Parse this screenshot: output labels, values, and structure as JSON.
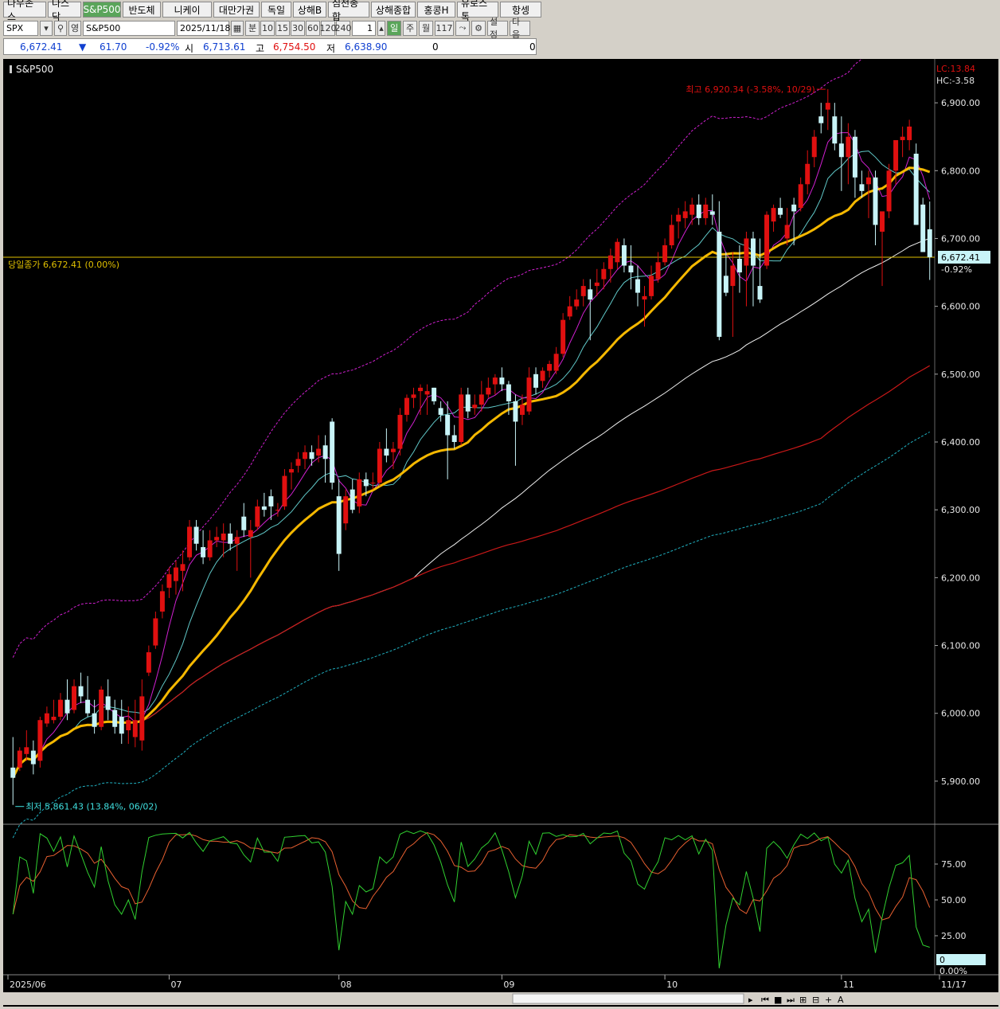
{
  "tabs": [
    "다우존스",
    "나스닥",
    "S&P500",
    "반도체",
    "니케이",
    "대만가권",
    "독일",
    "상해B",
    "심천종합",
    "상해종합",
    "홍콩H",
    "유로스톡",
    "항셍"
  ],
  "active_tab": "S&P500",
  "toolbar": {
    "symbol": "SPX",
    "symbol_name": "S&P500",
    "date": "2025/11/18",
    "period_buttons": [
      "분",
      "10",
      "15",
      "30",
      "60",
      "120",
      "240"
    ],
    "tick_value": "1",
    "day_label": "일",
    "week_label": "주",
    "month_label": "월",
    "count": "117",
    "settings_label": "설정",
    "next_label": "다음",
    "ref_label": "영"
  },
  "quote": {
    "last": "6,672.41",
    "change": "61.70",
    "change_pct": "-0.92%",
    "open_label": "시",
    "open": "6,713.61",
    "high_label": "고",
    "high": "6,754.50",
    "low_label": "저",
    "low": "6,638.90",
    "vol1": "0",
    "vol2": "0"
  },
  "colors": {
    "up": "#e01010",
    "down": "#c8f4f8",
    "ma_yellow": "#f5b800",
    "ma_white": "#f0f0f0",
    "ma_red": "#c81818",
    "ma_cyan": "#20b0c0",
    "ma_magenta": "#d020d0",
    "close_line": "#e0c000"
  },
  "chart_data": {
    "type": "candlestick",
    "title": "S&P500",
    "y_ticks": [
      "6,900.00",
      "6,800.00",
      "6,700.00",
      "6,600.00",
      "6,500.00",
      "6,400.00",
      "6,300.00",
      "6,200.00",
      "6,100.00",
      "6,000.00",
      "5,900.00"
    ],
    "ylim": [
      5840,
      6960
    ],
    "x_labels": [
      "2025/06",
      "07",
      "08",
      "09",
      "10",
      "11",
      "11/17"
    ],
    "lc_label": "LC:13.84",
    "hc_label": "HC:-3.58",
    "close_label": "당일종가 6,672.41 (0.00%)",
    "close_value": 6672.41,
    "last_price_label": "6,672.41",
    "last_change_label": "-0.92%",
    "high_annotation": "최고 6,920.34 (-3.58%, 10/29)",
    "low_annotation": "최저 5,861.43 (13.84%, 06/02)",
    "candles": [
      [
        5920,
        5965,
        5865,
        5905
      ],
      [
        5920,
        5950,
        5915,
        5945
      ],
      [
        5940,
        5975,
        5930,
        5950
      ],
      [
        5945,
        5960,
        5910,
        5925
      ],
      [
        5930,
        5995,
        5920,
        5990
      ],
      [
        5985,
        6010,
        5980,
        6000
      ],
      [
        5990,
        6020,
        5985,
        5995
      ],
      [
        5995,
        6030,
        5990,
        6020
      ],
      [
        6020,
        6050,
        5990,
        6000
      ],
      [
        6005,
        6050,
        6000,
        6040
      ],
      [
        6040,
        6060,
        6015,
        6025
      ],
      [
        6020,
        6055,
        5995,
        6000
      ],
      [
        6000,
        6020,
        5970,
        5980
      ],
      [
        5980,
        6040,
        5975,
        6035
      ],
      [
        6025,
        6050,
        5990,
        6005
      ],
      [
        6005,
        6020,
        5970,
        5980
      ],
      [
        5995,
        6020,
        5955,
        5970
      ],
      [
        5975,
        6010,
        5955,
        5990
      ],
      [
        5965,
        6020,
        5950,
        5990
      ],
      [
        5960,
        6050,
        5945,
        6025
      ],
      [
        6060,
        6100,
        6055,
        6090
      ],
      [
        6100,
        6150,
        6095,
        6140
      ],
      [
        6150,
        6190,
        6140,
        6180
      ],
      [
        6185,
        6215,
        6170,
        6205
      ],
      [
        6195,
        6225,
        6175,
        6215
      ],
      [
        6210,
        6240,
        6180,
        6220
      ],
      [
        6230,
        6285,
        6225,
        6275
      ],
      [
        6275,
        6285,
        6240,
        6250
      ],
      [
        6245,
        6270,
        6220,
        6230
      ],
      [
        6230,
        6270,
        6225,
        6255
      ],
      [
        6255,
        6275,
        6245,
        6260
      ],
      [
        6255,
        6280,
        6230,
        6265
      ],
      [
        6265,
        6280,
        6240,
        6250
      ],
      [
        6250,
        6270,
        6210,
        6260
      ],
      [
        6290,
        6310,
        6260,
        6270
      ],
      [
        6260,
        6285,
        6200,
        6270
      ],
      [
        6275,
        6315,
        6270,
        6305
      ],
      [
        6305,
        6325,
        6290,
        6300
      ],
      [
        6320,
        6330,
        6285,
        6305
      ],
      [
        6300,
        6310,
        6290,
        6300
      ],
      [
        6305,
        6360,
        6300,
        6350
      ],
      [
        6355,
        6370,
        6330,
        6360
      ],
      [
        6365,
        6385,
        6355,
        6375
      ],
      [
        6375,
        6395,
        6360,
        6385
      ],
      [
        6385,
        6395,
        6365,
        6375
      ],
      [
        6380,
        6410,
        6370,
        6390
      ],
      [
        6395,
        6410,
        6340,
        6375
      ],
      [
        6430,
        6435,
        6330,
        6340
      ],
      [
        6320,
        6345,
        6210,
        6235
      ],
      [
        6280,
        6330,
        6270,
        6320
      ],
      [
        6330,
        6345,
        6295,
        6300
      ],
      [
        6305,
        6355,
        6295,
        6345
      ],
      [
        6345,
        6355,
        6320,
        6335
      ],
      [
        6340,
        6355,
        6330,
        6340
      ],
      [
        6340,
        6400,
        6335,
        6390
      ],
      [
        6390,
        6420,
        6370,
        6380
      ],
      [
        6385,
        6400,
        6360,
        6390
      ],
      [
        6390,
        6450,
        6380,
        6440
      ],
      [
        6440,
        6470,
        6430,
        6465
      ],
      [
        6465,
        6480,
        6450,
        6470
      ],
      [
        6475,
        6485,
        6440,
        6480
      ],
      [
        6470,
        6485,
        6440,
        6475
      ],
      [
        6480,
        6480,
        6455,
        6460
      ],
      [
        6450,
        6460,
        6430,
        6440
      ],
      [
        6440,
        6460,
        6345,
        6410
      ],
      [
        6410,
        6425,
        6390,
        6400
      ],
      [
        6400,
        6480,
        6395,
        6470
      ],
      [
        6470,
        6480,
        6435,
        6445
      ],
      [
        6450,
        6470,
        6440,
        6455
      ],
      [
        6455,
        6490,
        6445,
        6470
      ],
      [
        6470,
        6495,
        6465,
        6480
      ],
      [
        6485,
        6500,
        6470,
        6495
      ],
      [
        6495,
        6510,
        6475,
        6485
      ],
      [
        6485,
        6490,
        6440,
        6460
      ],
      [
        6460,
        6470,
        6365,
        6430
      ],
      [
        6440,
        6470,
        6425,
        6455
      ],
      [
        6445,
        6510,
        6440,
        6495
      ],
      [
        6500,
        6510,
        6470,
        6480
      ],
      [
        6490,
        6510,
        6480,
        6505
      ],
      [
        6505,
        6520,
        6495,
        6515
      ],
      [
        6505,
        6540,
        6500,
        6530
      ],
      [
        6530,
        6590,
        6525,
        6580
      ],
      [
        6585,
        6615,
        6580,
        6600
      ],
      [
        6600,
        6625,
        6595,
        6610
      ],
      [
        6615,
        6640,
        6600,
        6630
      ],
      [
        6625,
        6640,
        6550,
        6610
      ],
      [
        6630,
        6655,
        6615,
        6635
      ],
      [
        6640,
        6665,
        6625,
        6655
      ],
      [
        6655,
        6685,
        6635,
        6675
      ],
      [
        6665,
        6700,
        6655,
        6695
      ],
      [
        6690,
        6700,
        6650,
        6660
      ],
      [
        6660,
        6690,
        6625,
        6650
      ],
      [
        6640,
        6660,
        6600,
        6620
      ],
      [
        6610,
        6630,
        6570,
        6615
      ],
      [
        6615,
        6660,
        6610,
        6645
      ],
      [
        6640,
        6680,
        6635,
        6665
      ],
      [
        6665,
        6700,
        6660,
        6690
      ],
      [
        6690,
        6735,
        6685,
        6720
      ],
      [
        6725,
        6745,
        6700,
        6735
      ],
      [
        6730,
        6755,
        6715,
        6740
      ],
      [
        6735,
        6760,
        6720,
        6750
      ],
      [
        6750,
        6765,
        6720,
        6730
      ],
      [
        6730,
        6760,
        6720,
        6750
      ],
      [
        6740,
        6765,
        6720,
        6735
      ],
      [
        6710,
        6755,
        6550,
        6555
      ],
      [
        6645,
        6680,
        6615,
        6620
      ],
      [
        6630,
        6680,
        6555,
        6660
      ],
      [
        6670,
        6690,
        6620,
        6650
      ],
      [
        6660,
        6710,
        6600,
        6700
      ],
      [
        6700,
        6710,
        6600,
        6660
      ],
      [
        6630,
        6700,
        6605,
        6610
      ],
      [
        6660,
        6740,
        6655,
        6735
      ],
      [
        6725,
        6750,
        6710,
        6745
      ],
      [
        6745,
        6760,
        6730,
        6735
      ],
      [
        6700,
        6745,
        6690,
        6720
      ],
      [
        6750,
        6760,
        6690,
        6740
      ],
      [
        6745,
        6790,
        6740,
        6780
      ],
      [
        6780,
        6830,
        6765,
        6810
      ],
      [
        6820,
        6860,
        6805,
        6850
      ],
      [
        6880,
        6900,
        6855,
        6870
      ],
      [
        6890,
        6920,
        6860,
        6900
      ],
      [
        6880,
        6900,
        6830,
        6840
      ],
      [
        6840,
        6880,
        6770,
        6820
      ],
      [
        6820,
        6870,
        6780,
        6850
      ],
      [
        6850,
        6860,
        6760,
        6790
      ],
      [
        6780,
        6800,
        6760,
        6770
      ],
      [
        6780,
        6800,
        6730,
        6790
      ],
      [
        6790,
        6800,
        6690,
        6720
      ],
      [
        6710,
        6735,
        6630,
        6740
      ],
      [
        6740,
        6810,
        6730,
        6800
      ],
      [
        6800,
        6840,
        6780,
        6845
      ],
      [
        6845,
        6865,
        6820,
        6850
      ],
      [
        6845,
        6875,
        6830,
        6865
      ],
      [
        6825,
        6840,
        6720,
        6720
      ],
      [
        6750,
        6760,
        6690,
        6680
      ],
      [
        6713.61,
        6754.5,
        6638.9,
        6672.41
      ]
    ],
    "oscillator": {
      "ticks": [
        "75.00",
        "50.00",
        "25.00"
      ],
      "ylim": [
        0,
        100
      ],
      "last_value_label": "0",
      "last_pct_label": "0.00%"
    }
  }
}
